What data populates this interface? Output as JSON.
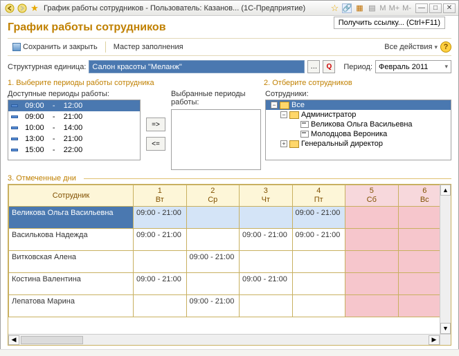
{
  "titlebar": {
    "text": "График работы сотрудников - Пользователь: Казанов... (1С-Предприятие)",
    "mini_labels": [
      "M",
      "M+",
      "M-"
    ],
    "get_link": "Получить ссылку... (Ctrl+F11)"
  },
  "page_title": "График работы сотрудников",
  "toolbar": {
    "save_close": "Сохранить и закрыть",
    "fill_master": "Мастер заполнения",
    "all_actions": "Все действия"
  },
  "filter": {
    "unit_label": "Структурная единица:",
    "unit_value": "Салон красоты \"Меланж\"",
    "period_label": "Период:",
    "period_value": "Февраль 2011"
  },
  "group1_title": "1. Выберите периоды работы сотрудника",
  "group2_title": "2. Отберите сотрудников",
  "list_avail_label": "Доступные периоды работы:",
  "list_sel_label": "Выбранные периоды работы:",
  "avail_periods": [
    {
      "from": "09:00",
      "to": "12:00",
      "selected": true
    },
    {
      "from": "09:00",
      "to": "21:00",
      "selected": false
    },
    {
      "from": "10:00",
      "to": "14:00",
      "selected": false
    },
    {
      "from": "13:00",
      "to": "21:00",
      "selected": false
    },
    {
      "from": "15:00",
      "to": "22:00",
      "selected": false
    }
  ],
  "buttons": {
    "add": "=>",
    "remove": "<="
  },
  "tree_label": "Сотрудники:",
  "tree": {
    "root": "Все",
    "nodes": [
      {
        "label": "Администратор",
        "children": [
          {
            "label": "Великова Ольга Васильевна"
          },
          {
            "label": "Молодцова Вероника"
          }
        ]
      },
      {
        "label": "Генеральный директор",
        "children": []
      }
    ]
  },
  "section3_title": "3. Отмеченные дни",
  "chart_data": {
    "type": "table",
    "employee_header": "Сотрудник",
    "days": [
      {
        "num": "1",
        "dow": "Вт",
        "weekend": false
      },
      {
        "num": "2",
        "dow": "Ср",
        "weekend": false
      },
      {
        "num": "3",
        "dow": "Чт",
        "weekend": false
      },
      {
        "num": "4",
        "dow": "Пт",
        "weekend": false
      },
      {
        "num": "5",
        "dow": "Сб",
        "weekend": true
      },
      {
        "num": "6",
        "dow": "Вс",
        "weekend": true
      }
    ],
    "rows": [
      {
        "name": "Великова Ольга Васильевна",
        "selected": true,
        "cells": [
          "09:00 - 21:00",
          "",
          "",
          "09:00 - 21:00",
          "",
          ""
        ],
        "highlight": [
          true,
          true,
          true,
          true,
          false,
          false
        ]
      },
      {
        "name": "Василькова Надежда",
        "selected": false,
        "cells": [
          "09:00 - 21:00",
          "",
          "09:00 - 21:00",
          "09:00 - 21:00",
          "",
          ""
        ],
        "highlight": [
          false,
          false,
          false,
          false,
          false,
          false
        ]
      },
      {
        "name": "Витковская Алена",
        "selected": false,
        "cells": [
          "",
          "09:00 - 21:00",
          "",
          "",
          "",
          ""
        ],
        "highlight": [
          false,
          false,
          false,
          false,
          false,
          false
        ]
      },
      {
        "name": "Костина Валентина",
        "selected": false,
        "cells": [
          "09:00 - 21:00",
          "",
          "09:00 - 21:00",
          "",
          "",
          ""
        ],
        "highlight": [
          false,
          false,
          false,
          false,
          false,
          false
        ]
      },
      {
        "name": "Лепатова Марина",
        "selected": false,
        "cells": [
          "",
          "09:00 - 21:00",
          "",
          "",
          "",
          ""
        ],
        "highlight": [
          false,
          false,
          false,
          false,
          false,
          false
        ]
      }
    ]
  }
}
